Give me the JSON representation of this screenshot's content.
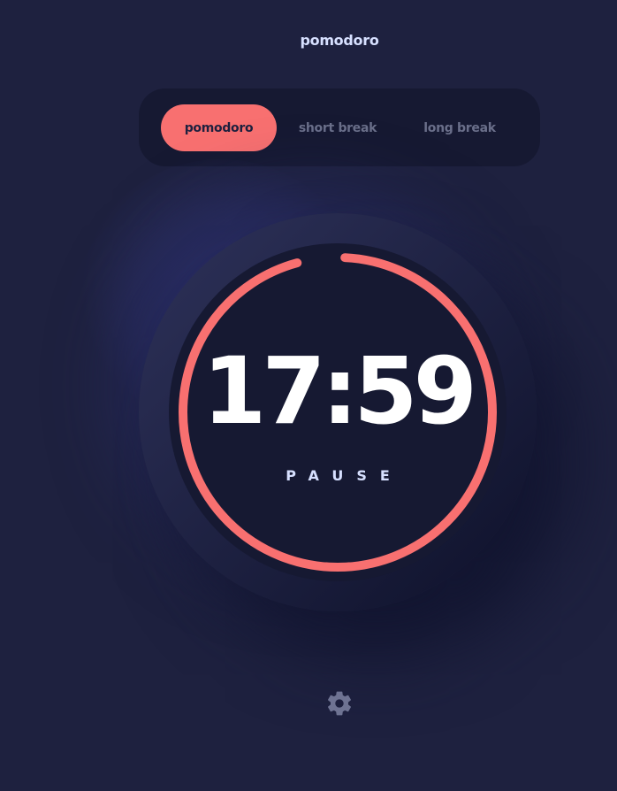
{
  "app": {
    "title": "pomodoro"
  },
  "modes": {
    "pomodoro": "pomodoro",
    "short_break": "short break",
    "long_break": "long break",
    "active": "pomodoro"
  },
  "timer": {
    "time": "17:59",
    "action_label": "PAUSE",
    "progress_fraction": 0.95
  },
  "colors": {
    "background": "#1e213f",
    "accent": "#f87070",
    "panel": "#161932",
    "text_light": "#d7e0ff",
    "text_muted": "#6a6f8a"
  },
  "icons": {
    "settings": "gear-icon"
  }
}
